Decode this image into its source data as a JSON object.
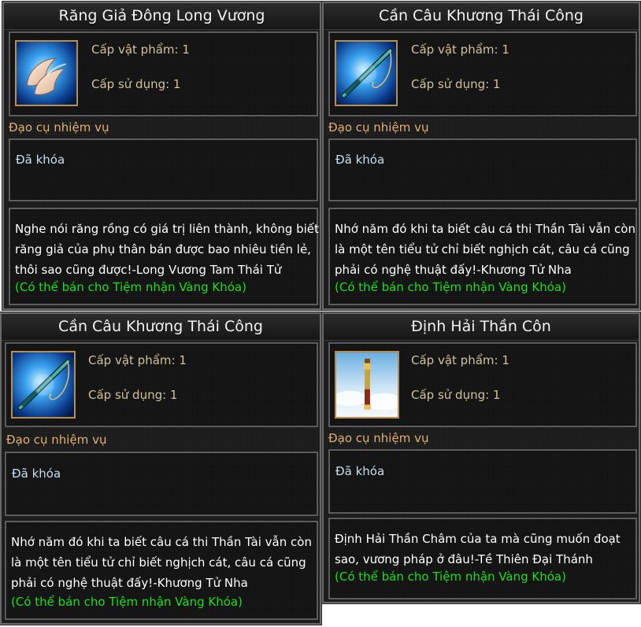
{
  "cards": [
    {
      "title": "Răng Giả Đông Long Vương",
      "icon": "fang-icon",
      "level_item": "Cấp vật phẩm: 1",
      "level_use": "Cấp sử dụng: 1",
      "category": "Đạo cụ nhiệm vụ",
      "lock": "Đã khóa",
      "desc_lines": [
        "Nghe nói răng rồng có giá trị liên thành, không biết",
        " răng giả của phụ thân bán được bao nhiêu tiền lẻ,",
        " thôi sao cũng được!-Long Vương Tam Thái Tử"
      ],
      "sell": "(Có thể bán cho Tiệm nhận Vàng Khóa)"
    },
    {
      "title": "Cần Câu Khương Thái Công",
      "icon": "fishing-rod-icon",
      "level_item": "Cấp vật phẩm: 1",
      "level_use": "Cấp sử dụng: 1",
      "category": "Đạo cụ nhiệm vụ",
      "lock": "Đã khóa",
      "desc_lines": [
        "Nhớ năm đó khi ta biết câu cá thi Thần Tài vẫn còn",
        " là một tên tiểu tử chỉ biết nghịch cát, câu cá cũng",
        " phải có nghệ thuật đấy!-Khương Tử Nha"
      ],
      "sell": "(Có thể bán cho Tiệm nhận Vàng Khóa)"
    },
    {
      "title": "Cần Câu Khương Thái Công",
      "icon": "fishing-rod-icon",
      "level_item": "Cấp vật phẩm: 1",
      "level_use": "Cấp sử dụng: 1",
      "category": "Đạo cụ nhiệm vụ",
      "lock": "Đã khóa",
      "desc_lines": [
        "Nhớ năm đó khi ta biết câu cá thi Thần Tài vẫn còn",
        " là một tên tiểu tử chỉ biết nghịch cát, câu cá cũng",
        " phải có nghệ thuật đấy!-Khương Tử Nha"
      ],
      "sell": "(Có thể bán cho Tiệm nhận Vàng Khóa)"
    },
    {
      "title": "Định Hải Thần Côn",
      "icon": "golden-staff-icon",
      "level_item": "Cấp vật phẩm: 1",
      "level_use": "Cấp sử dụng: 1",
      "category": "Đạo cụ nhiệm vụ",
      "lock": "Đã khóa",
      "desc_lines": [
        "Định Hải Thần Châm của ta mà cũng muốn đoạt",
        " sao, vương pháp ở đâu!-Tề Thiên Đại Thánh"
      ],
      "sell": "(Có thể bán cho Tiệm nhận Vàng Khóa)"
    }
  ]
}
